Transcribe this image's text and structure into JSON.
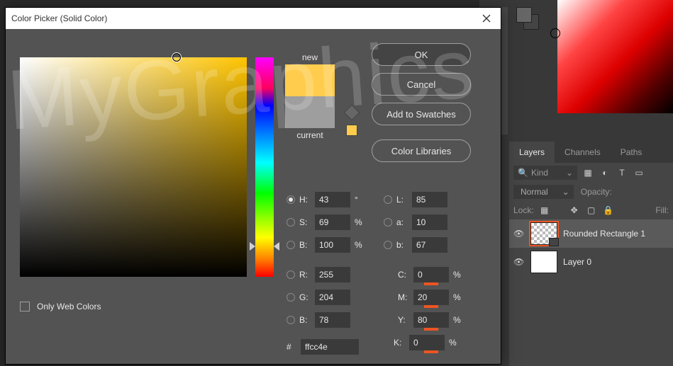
{
  "watermark": "MyGraphics",
  "dialog": {
    "title": "Color Picker (Solid Color)",
    "preview_new": "new",
    "preview_current": "current",
    "buttons": {
      "ok": "OK",
      "cancel": "Cancel",
      "add_swatches": "Add to Swatches",
      "color_libs": "Color Libraries"
    },
    "fields": {
      "H": {
        "label": "H:",
        "value": "43",
        "unit": "°"
      },
      "S": {
        "label": "S:",
        "value": "69",
        "unit": "%"
      },
      "Bv": {
        "label": "B:",
        "value": "100",
        "unit": "%"
      },
      "R": {
        "label": "R:",
        "value": "255"
      },
      "G": {
        "label": "G:",
        "value": "204"
      },
      "B": {
        "label": "B:",
        "value": "78"
      },
      "L": {
        "label": "L:",
        "value": "85"
      },
      "a": {
        "label": "a:",
        "value": "10"
      },
      "bb": {
        "label": "b:",
        "value": "67"
      },
      "C": {
        "label": "C:",
        "value": "0",
        "unit": "%"
      },
      "M": {
        "label": "M:",
        "value": "20",
        "unit": "%"
      },
      "Y": {
        "label": "Y:",
        "value": "80",
        "unit": "%"
      },
      "K": {
        "label": "K:",
        "value": "0",
        "unit": "%"
      },
      "hex": {
        "label": "#",
        "value": "ffcc4e"
      }
    },
    "webcolors": "Only Web Colors"
  },
  "panel": {
    "tabs": [
      "Layers",
      "Channels",
      "Paths"
    ],
    "kind_placeholder": "Kind",
    "blend": "Normal",
    "opacity_label": "Opacity:",
    "lock_label": "Lock:",
    "fill_label": "Fill:",
    "layers": [
      {
        "name": "Rounded Rectangle 1"
      },
      {
        "name": "Layer 0"
      }
    ]
  }
}
